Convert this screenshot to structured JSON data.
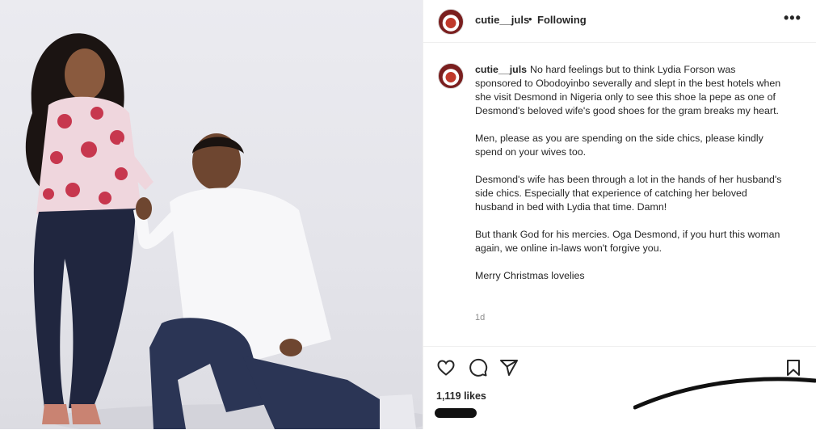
{
  "post": {
    "username": "cutie__juls",
    "separator": "•",
    "follow_status": "Following",
    "more_label": "•••",
    "caption_paragraphs": [
      "No hard feelings but to think Lydia Forson was sponsored to Obodoyinbo severally and slept in the best hotels when she visit Desmond in Nigeria only to see this shoe la pepe as one of Desmond's beloved wife's good shoes for the gram breaks my heart.",
      "Men, please as you are spending on the side chics, please kindly spend on your wives too.",
      "Desmond's wife has been through a lot in the hands of her husband's side chics. Especially that experience of catching her beloved husband in bed with Lydia that time. Damn!",
      "But thank God for his mercies. Oga Desmond, if you hurt this woman again, we online in-laws won't forgive you.",
      "Merry Christmas lovelies"
    ],
    "time_ago": "1d",
    "likes": "1,119 likes"
  },
  "icons": {
    "like": "heart-icon",
    "comment": "comment-icon",
    "share": "send-icon",
    "save": "bookmark-icon",
    "more": "more-options-icon"
  },
  "colors": {
    "text": "#262626",
    "secondary": "#8e8e8e",
    "divider": "#efefef"
  }
}
